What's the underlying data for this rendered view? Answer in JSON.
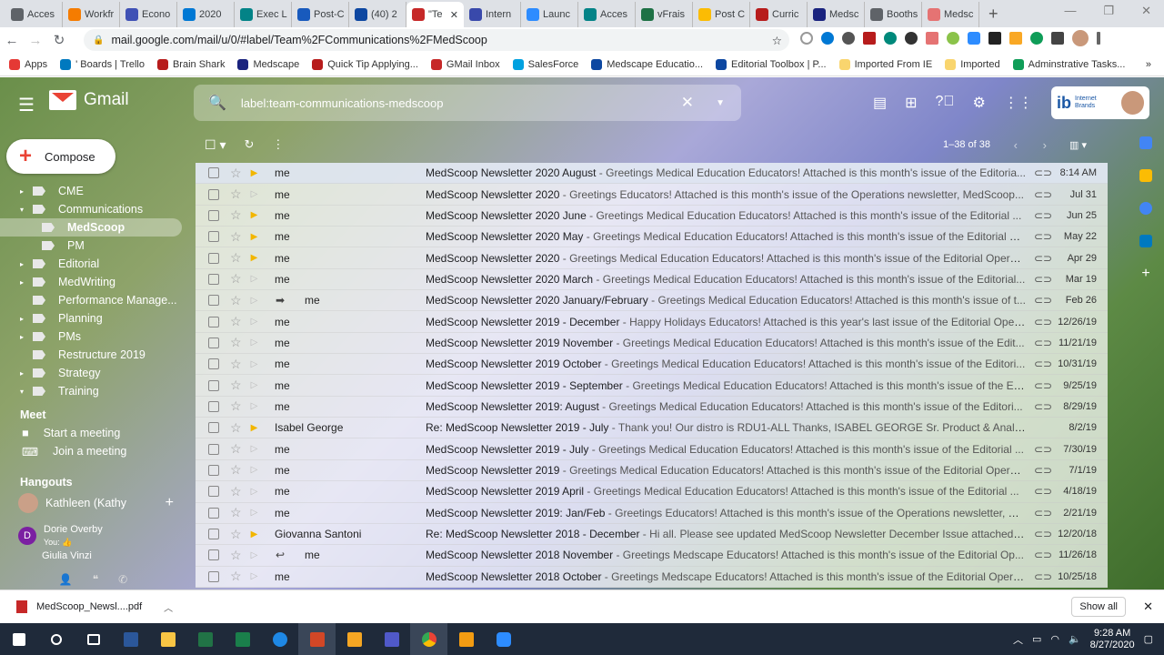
{
  "browser": {
    "tabs": [
      {
        "label": "Acces",
        "color": "#5f6368"
      },
      {
        "label": "Workfr",
        "color": "#f57c00"
      },
      {
        "label": "Econo",
        "color": "#3f51b5"
      },
      {
        "label": "2020",
        "color": "#0078d4"
      },
      {
        "label": "Exec L",
        "color": "#038387"
      },
      {
        "label": "Post-C",
        "color": "#185abd"
      },
      {
        "label": "(40) 2",
        "color": "#0d47a1"
      },
      {
        "label": "\"Te",
        "color": "#c62828",
        "active": true
      },
      {
        "label": "Intern",
        "color": "#3949ab"
      },
      {
        "label": "Launc",
        "color": "#2d8cff"
      },
      {
        "label": "Acces",
        "color": "#038387"
      },
      {
        "label": "vFrais",
        "color": "#1e7145"
      },
      {
        "label": "Post C",
        "color": "#fbbc04"
      },
      {
        "label": "Curric",
        "color": "#b71c1c"
      },
      {
        "label": "Medsc",
        "color": "#1a237e"
      },
      {
        "label": "Booths",
        "color": "#5f6368"
      },
      {
        "label": "Medsc",
        "color": "#e57373"
      }
    ],
    "close_tab": "✕",
    "new_tab": "+",
    "window": {
      "min": "—",
      "max": "❐",
      "close": "✕"
    },
    "url": "mail.google.com/mail/u/0/#label/Team%2FCommunications%2FMedScoop",
    "bookmarks": [
      "Apps",
      "' Boards | Trello",
      "Brain Shark",
      "Medscape",
      "Quick Tip Applying...",
      "GMail Inbox",
      "SalesForce",
      "Medscape Educatio...",
      "Editorial Toolbox | P...",
      "Imported From IE",
      "Imported",
      "Adminstrative Tasks..."
    ],
    "bookmark_more": "»"
  },
  "gmail": {
    "brand": "Gmail",
    "search_value": "label:team-communications-medscoop",
    "compose": "Compose",
    "account_brand": "ib",
    "account_brand_text": "Internet Brands",
    "labels": [
      {
        "name": "CME",
        "indent": 0,
        "caret": "▸"
      },
      {
        "name": "Communications",
        "indent": 0,
        "caret": "▾"
      },
      {
        "name": "MedScoop",
        "indent": 1,
        "selected": true
      },
      {
        "name": "PM",
        "indent": 1
      },
      {
        "name": "Editorial",
        "indent": 0,
        "caret": "▸"
      },
      {
        "name": "MedWriting",
        "indent": 0,
        "caret": "▸"
      },
      {
        "name": "Performance Manage...",
        "indent": 0
      },
      {
        "name": "Planning",
        "indent": 0,
        "caret": "▸"
      },
      {
        "name": "PMs",
        "indent": 0,
        "caret": "▸"
      },
      {
        "name": "Restructure 2019",
        "indent": 0
      },
      {
        "name": "Strategy",
        "indent": 0,
        "caret": "▸"
      },
      {
        "name": "Training",
        "indent": 0,
        "caret": "▾"
      }
    ],
    "meet": {
      "title": "Meet",
      "start": "Start a meeting",
      "join": "Join a meeting"
    },
    "hangouts": {
      "title": "Hangouts",
      "me": "Kathleen (Kathy",
      "contacts": [
        {
          "initial": "D",
          "name": "Dorie Overby",
          "status": "You: 👍"
        },
        {
          "name": "Giulia Vinzi"
        }
      ]
    },
    "pagination": "1–38 of 38",
    "emails": [
      {
        "sender": "me",
        "subject": "MedScoop Newsletter 2020 August",
        "snippet": "Greetings Medical Education Educators! Attached is this month's issue of the Editoria...",
        "date": "8:14 AM",
        "imp": true,
        "att": true
      },
      {
        "sender": "me",
        "subject": "MedScoop Newsletter 2020",
        "snippet": "Greetings Educators! Attached is this month's issue of the Operations newsletter, MedScoop...",
        "date": "Jul 31",
        "imp": false,
        "att": true
      },
      {
        "sender": "me",
        "subject": "MedScoop Newsletter 2020 June",
        "snippet": "Greetings Medical Education Educators! Attached is this month's issue of the Editorial ...",
        "date": "Jun 25",
        "imp": true,
        "att": true
      },
      {
        "sender": "me",
        "subject": "MedScoop Newsletter 2020 May",
        "snippet": "Greetings Medical Education Educators! Attached is this month's issue of the Editorial O...",
        "date": "May 22",
        "imp": true,
        "att": true
      },
      {
        "sender": "me",
        "subject": "MedScoop Newsletter 2020",
        "snippet": "Greetings Medical Education Educators! Attached is this month's issue of the Editorial Operat...",
        "date": "Apr 29",
        "imp": true,
        "att": true
      },
      {
        "sender": "me",
        "subject": "MedScoop Newsletter 2020 March",
        "snippet": "Greetings Medical Education Educators! Attached is this month's issue of the Editorial...",
        "date": "Mar 19",
        "imp": false,
        "att": true
      },
      {
        "sender": "me",
        "subject": "MedScoop Newsletter 2020 January/February",
        "snippet": "Greetings Medical Education Educators! Attached is this month's issue of t...",
        "date": "Feb 26",
        "imp": false,
        "att": true,
        "arrow": "➡"
      },
      {
        "sender": "me",
        "subject": "MedScoop Newsletter 2019 - December",
        "snippet": "Happy Holidays Educators! Attached is this year's last issue of the Editorial Oper...",
        "date": "12/26/19",
        "imp": false,
        "att": true
      },
      {
        "sender": "me",
        "subject": "MedScoop Newsletter 2019 November",
        "snippet": "Greetings Medical Education Educators! Attached is this month's issue of the Edit...",
        "date": "11/21/19",
        "imp": false,
        "att": true
      },
      {
        "sender": "me",
        "subject": "MedScoop Newsletter 2019 October",
        "snippet": "Greetings Medical Education Educators! Attached is this month's issue of the Editori...",
        "date": "10/31/19",
        "imp": false,
        "att": true
      },
      {
        "sender": "me",
        "subject": "MedScoop Newsletter 2019 - September",
        "snippet": "Greetings Medical Education Educators! Attached is this month's issue of the Ed...",
        "date": "9/25/19",
        "imp": false,
        "att": true
      },
      {
        "sender": "me",
        "subject": "MedScoop Newsletter 2019: August",
        "snippet": "Greetings Medical Education Educators! Attached is this month's issue of the Editori...",
        "date": "8/29/19",
        "imp": false,
        "att": true
      },
      {
        "sender": "Isabel George",
        "subject": "Re: MedScoop Newsletter 2019 - July",
        "snippet": "Thank you! Our distro is RDU1-ALL Thanks, ISABEL GEORGE Sr. Product & Analytics...",
        "date": "8/2/19",
        "imp": true,
        "att": false
      },
      {
        "sender": "me",
        "subject": "MedScoop Newsletter 2019 - July",
        "snippet": "Greetings Medical Education Educators! Attached is this month's issue of the Editorial ...",
        "date": "7/30/19",
        "imp": false,
        "att": true
      },
      {
        "sender": "me",
        "subject": "MedScoop Newsletter 2019",
        "snippet": "Greetings Medical Education Educators! Attached is this month's issue of the Editorial Operat...",
        "date": "7/1/19",
        "imp": false,
        "att": true
      },
      {
        "sender": "me",
        "subject": "MedScoop Newsletter 2019 April",
        "snippet": "Greetings Medical Education Educators! Attached is this month's issue of the Editorial ...",
        "date": "4/18/19",
        "imp": false,
        "att": true
      },
      {
        "sender": "me",
        "subject": "MedScoop Newsletter 2019: Jan/Feb",
        "snippet": "Greetings Educators! Attached is this month's issue of the Operations newsletter, M...",
        "date": "2/21/19",
        "imp": false,
        "att": true
      },
      {
        "sender": "Giovanna Santoni",
        "subject": "Re: MedScoop Newsletter 2018 - December",
        "snippet": "Hi all. Please see updated MedScoop Newsletter December Issue attached. ...",
        "date": "12/20/18",
        "imp": true,
        "att": true
      },
      {
        "sender": "me",
        "subject": "MedScoop Newsletter 2018 November",
        "snippet": "Greetings Medscape Educators! Attached is this month's issue of the Editorial Op...",
        "date": "11/26/18",
        "imp": false,
        "att": true,
        "arrow": "↩"
      },
      {
        "sender": "me",
        "subject": "MedScoop Newsletter 2018 October",
        "snippet": "Greetings Medscape Educators! Attached is this month's issue of the Editorial Opera...",
        "date": "10/25/18",
        "imp": false,
        "att": true
      }
    ]
  },
  "download": {
    "file": "MedScoop_Newsl....pdf",
    "show_all": "Show all",
    "close": "✕"
  },
  "taskbar": {
    "time": "9:28 AM",
    "date": "8/27/2020"
  }
}
